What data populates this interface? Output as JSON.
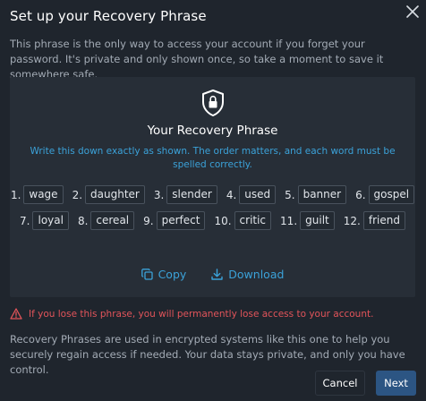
{
  "dialog": {
    "title": "Set up your Recovery Phrase",
    "intro": "This phrase is the only way to access your account if you forget your password. It's private and only shown once, so take a moment to save it somewhere safe."
  },
  "panel": {
    "heading": "Your Recovery Phrase",
    "instruction": "Write this down exactly as shown. The order matters, and each word must be spelled correctly.",
    "words": [
      {
        "num": "1.",
        "word": "wage"
      },
      {
        "num": "2.",
        "word": "daughter"
      },
      {
        "num": "3.",
        "word": "slender"
      },
      {
        "num": "4.",
        "word": "used"
      },
      {
        "num": "5.",
        "word": "banner"
      },
      {
        "num": "6.",
        "word": "gospel"
      },
      {
        "num": "7.",
        "word": "loyal"
      },
      {
        "num": "8.",
        "word": "cereal"
      },
      {
        "num": "9.",
        "word": "perfect"
      },
      {
        "num": "10.",
        "word": "critic"
      },
      {
        "num": "11.",
        "word": "guilt"
      },
      {
        "num": "12.",
        "word": "friend"
      }
    ],
    "copy_label": "Copy",
    "download_label": "Download"
  },
  "warning": "If you lose this phrase, you will permanently lose access to your account.",
  "footnote": "Recovery Phrases are used in encrypted systems like this one to help you securely regain access if needed. Your data stays private, and only you have control.",
  "buttons": {
    "cancel": "Cancel",
    "next": "Next"
  },
  "colors": {
    "background": "#1f252d",
    "panel": "#272e37",
    "accent": "#3ba2d9",
    "danger": "#e2545a",
    "primary_button": "#2c5583"
  },
  "icons": {
    "close": "close-icon",
    "shield": "shield-lock-icon",
    "copy": "copy-icon",
    "download": "download-icon",
    "warning": "warning-icon"
  }
}
